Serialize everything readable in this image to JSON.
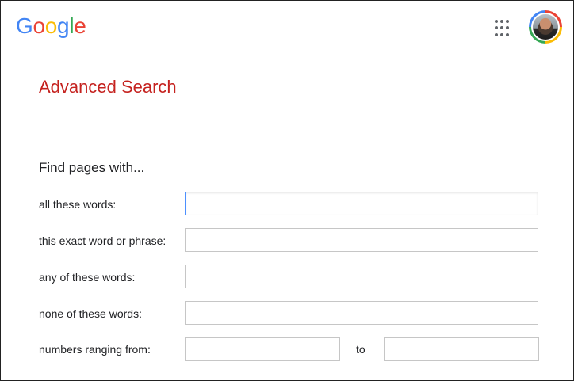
{
  "header": {
    "logo_letters": [
      {
        "char": "G",
        "color": "#4285f4"
      },
      {
        "char": "o",
        "color": "#ea4335"
      },
      {
        "char": "o",
        "color": "#fbbc05"
      },
      {
        "char": "g",
        "color": "#4285f4"
      },
      {
        "char": "l",
        "color": "#34a853"
      },
      {
        "char": "e",
        "color": "#ea4335"
      }
    ],
    "apps_icon": "apps-grid-icon",
    "avatar_icon": "account-avatar"
  },
  "page": {
    "title": "Advanced Search",
    "title_color": "#c5221f",
    "section_heading": "Find pages with..."
  },
  "form": {
    "all_words_label": "all these words:",
    "all_words_value": "",
    "exact_phrase_label": "this exact word or phrase:",
    "exact_phrase_value": "",
    "any_words_label": "any of these words:",
    "any_words_value": "",
    "none_words_label": "none of these words:",
    "none_words_value": "",
    "numbers_label": "numbers ranging from:",
    "numbers_from_value": "",
    "numbers_to_label": "to",
    "numbers_to_value": ""
  }
}
